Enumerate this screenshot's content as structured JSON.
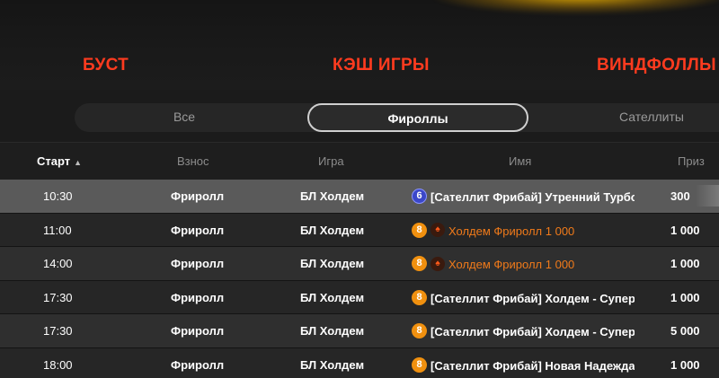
{
  "categories": {
    "boost": "БУСТ",
    "cash": "КЭШ ИГРЫ",
    "windfalls": "ВИНДФОЛЛЫ"
  },
  "tabs": [
    {
      "label": "Все",
      "active": false
    },
    {
      "label": "Фироллы",
      "active": true
    },
    {
      "label": "Сателлиты",
      "active": false
    }
  ],
  "table": {
    "headers": {
      "start": "Старт",
      "fee": "Взнос",
      "game": "Игра",
      "name": "Имя",
      "prize": "Приз"
    },
    "sort_indicator": "▲",
    "rows": [
      {
        "time": "10:30",
        "fee": "Фриролл",
        "game": "БЛ Холдем",
        "badge": "6",
        "badge_color": "#3b47c9",
        "spade": false,
        "name": "[Сателлит Фрибай] Утренний Турбо .",
        "name_color": "#ffffff",
        "prize": "300"
      },
      {
        "time": "11:00",
        "fee": "Фриролл",
        "game": "БЛ Холдем",
        "badge": "8",
        "badge_color": "#f0900f",
        "spade": true,
        "name": "Холдем Фриролл 1 000",
        "name_color": "#f07a1a",
        "prize": "1 000"
      },
      {
        "time": "14:00",
        "fee": "Фриролл",
        "game": "БЛ Холдем",
        "badge": "8",
        "badge_color": "#f0900f",
        "spade": true,
        "name": "Холдем Фриролл 1 000",
        "name_color": "#f07a1a",
        "prize": "1 000"
      },
      {
        "time": "17:30",
        "fee": "Фриролл",
        "game": "БЛ Холдем",
        "badge": "8",
        "badge_color": "#f0900f",
        "spade": false,
        "name": "[Сателлит Фрибай] Холдем - Супер .",
        "name_color": "#ffffff",
        "prize": "1 000"
      },
      {
        "time": "17:30",
        "fee": "Фриролл",
        "game": "БЛ Холдем",
        "badge": "8",
        "badge_color": "#f0900f",
        "spade": false,
        "name": "[Сателлит Фрибай] Холдем - Супер .",
        "name_color": "#ffffff",
        "prize": "5 000"
      },
      {
        "time": "18:00",
        "fee": "Фриролл",
        "game": "БЛ Холдем",
        "badge": "8",
        "badge_color": "#f0900f",
        "spade": false,
        "name": "[Сателлит Фрибай] Новая Надежда .",
        "name_color": "#ffffff",
        "prize": "1 000"
      }
    ]
  }
}
